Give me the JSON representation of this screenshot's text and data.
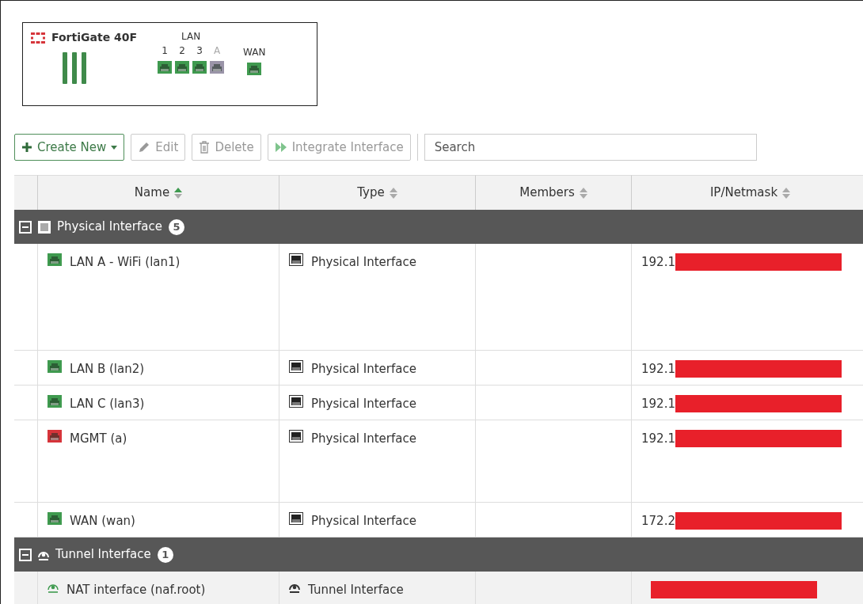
{
  "device": {
    "model": "FortiGate 40F",
    "lan_label": "LAN",
    "lan_ports": [
      {
        "label": "1",
        "color": "#3f9a4f",
        "disabled": false
      },
      {
        "label": "2",
        "color": "#3f9a4f",
        "disabled": false
      },
      {
        "label": "3",
        "color": "#3f9a4f",
        "disabled": false
      },
      {
        "label": "A",
        "color": "#9a94a8",
        "disabled": true
      }
    ],
    "wan_ports": [
      {
        "label": "WAN",
        "color": "#3f9a4f",
        "disabled": false
      }
    ]
  },
  "toolbar": {
    "buttons": [
      {
        "label": "Create New",
        "kind": "create",
        "disabled": false
      },
      {
        "label": "Edit",
        "kind": "edit",
        "disabled": true
      },
      {
        "label": "Delete",
        "kind": "delete",
        "disabled": true
      },
      {
        "label": "Integrate Interface",
        "kind": "integrate",
        "disabled": true
      }
    ],
    "search": {
      "placeholder": "Search"
    }
  },
  "table": {
    "columns": [
      {
        "label": "Name",
        "sorted": true
      },
      {
        "label": "Type",
        "sorted": false
      },
      {
        "label": "Members",
        "sorted": false
      },
      {
        "label": "IP/Netmask",
        "sorted": false
      }
    ],
    "groups": [
      {
        "label": "Physical Interface",
        "count": "5",
        "kind": "physical",
        "expanded": true,
        "rows": [
          {
            "name": "LAN A - WiFi (lan1)",
            "color": "#3f9a4f",
            "type": "Physical Interface",
            "ip": "192.1",
            "redacted": true,
            "tall": true,
            "highlighted": false
          },
          {
            "name": "LAN B (lan2)",
            "color": "#3f9a4f",
            "type": "Physical Interface",
            "ip": "192.1",
            "redacted": true,
            "tall": false,
            "highlighted": false
          },
          {
            "name": "LAN C (lan3)",
            "color": "#3f9a4f",
            "type": "Physical Interface",
            "ip": "192.1",
            "redacted": true,
            "tall": false,
            "highlighted": false
          },
          {
            "name": "MGMT (a)",
            "color": "#d6343a",
            "type": "Physical Interface",
            "ip": "192.1",
            "redacted": true,
            "tall": true,
            "highlighted": false
          },
          {
            "name": "WAN (wan)",
            "color": "#3f9a4f",
            "type": "Physical Interface",
            "ip": "172.2",
            "redacted": true,
            "tall": false,
            "highlighted": false
          }
        ]
      },
      {
        "label": "Tunnel Interface",
        "count": "1",
        "kind": "tunnel",
        "expanded": true,
        "rows": [
          {
            "name": "NAT interface (naf.root)",
            "color": "#3f9a4f",
            "type": "Tunnel Interface",
            "redacted": true,
            "tall": false,
            "highlighted": true
          }
        ]
      }
    ]
  }
}
